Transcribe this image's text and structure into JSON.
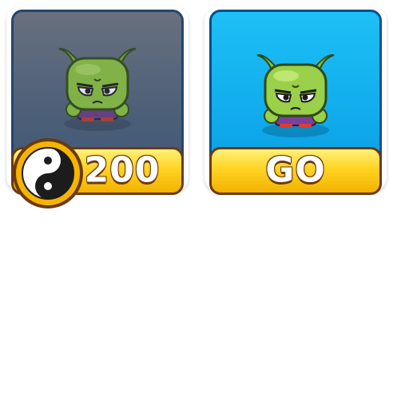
{
  "cards": [
    {
      "state": "locked",
      "character_icon": "green-alien-icon",
      "currency_icon": "yin-yang-coin-icon",
      "price": "200"
    },
    {
      "state": "unlocked",
      "character_icon": "green-alien-icon",
      "action_label": "GO"
    }
  ],
  "colors": {
    "locked_bg": "#4c5f78",
    "unlocked_bg": "#0ea8ea",
    "button_gold": "#ffd322",
    "button_border": "#6b3a12",
    "coin_gold": "#f5b400"
  }
}
